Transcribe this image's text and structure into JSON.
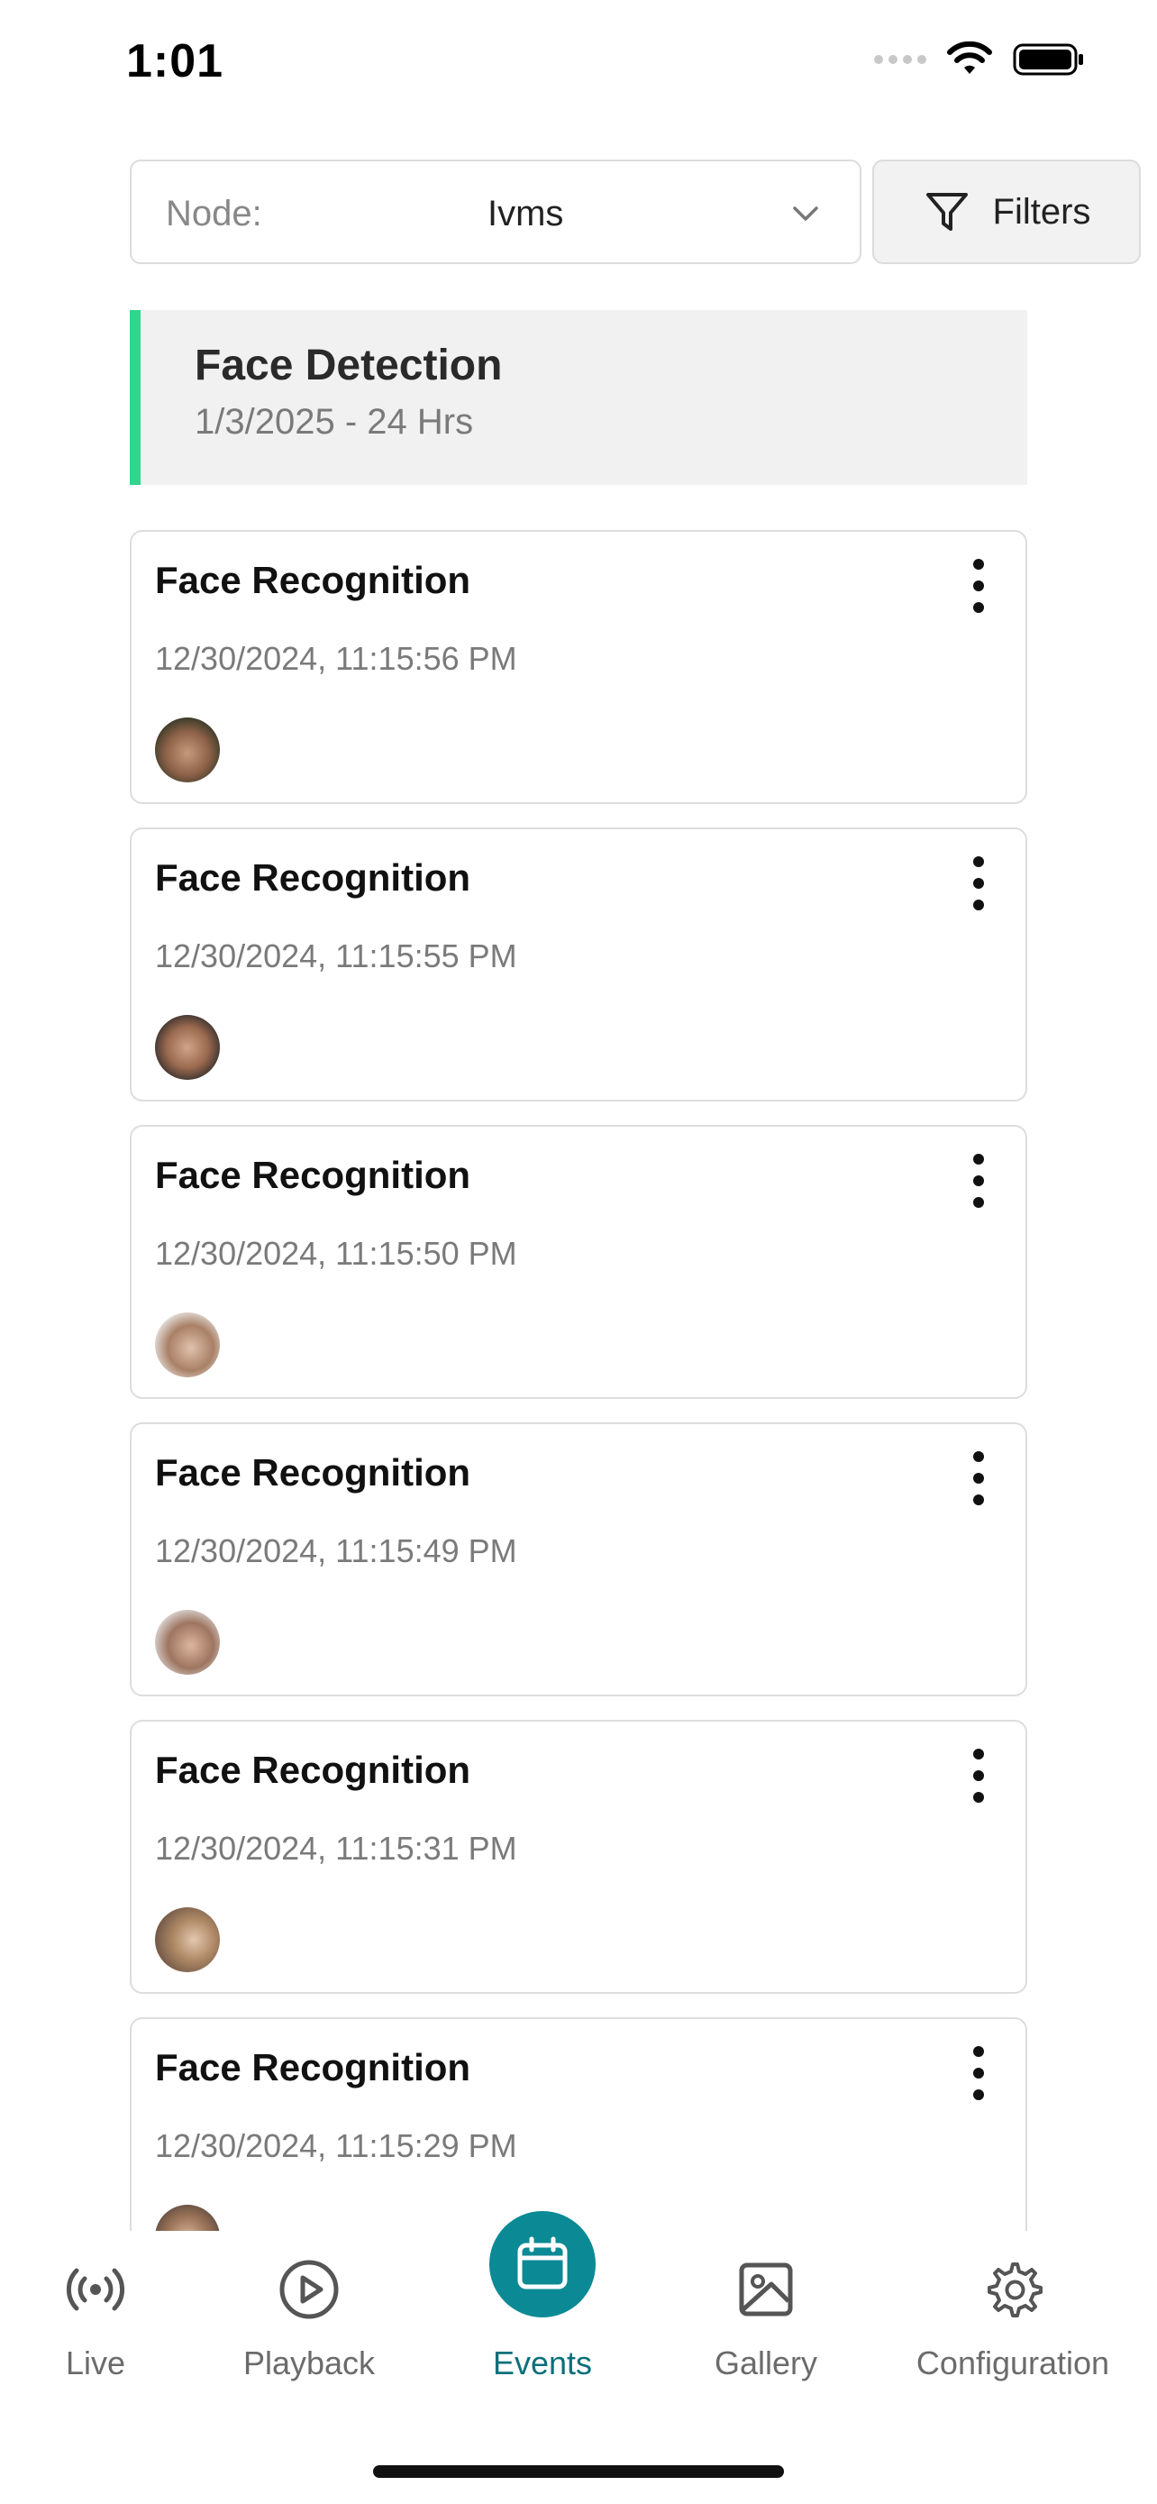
{
  "status_bar": {
    "time": "1:01"
  },
  "node_select": {
    "label": "Node:",
    "value": "Ivms"
  },
  "filters_button": {
    "label": "Filters"
  },
  "detection_banner": {
    "title": "Face Detection",
    "subtitle": "1/3/2025 - 24 Hrs",
    "accent_color": "#2ed68e"
  },
  "events": [
    {
      "title": "Face Recognition",
      "time": "12/30/2024, 11:15:56 PM"
    },
    {
      "title": "Face Recognition",
      "time": "12/30/2024, 11:15:55 PM"
    },
    {
      "title": "Face Recognition",
      "time": "12/30/2024, 11:15:50 PM"
    },
    {
      "title": "Face Recognition",
      "time": "12/30/2024, 11:15:49 PM"
    },
    {
      "title": "Face Recognition",
      "time": "12/30/2024, 11:15:31 PM"
    },
    {
      "title": "Face Recognition",
      "time": "12/30/2024, 11:15:29 PM"
    }
  ],
  "bottom_nav": {
    "active_color": "#0b8a95",
    "items": [
      {
        "label": "Live",
        "icon": "broadcast-icon"
      },
      {
        "label": "Playback",
        "icon": "play-circle-icon"
      },
      {
        "label": "Events",
        "icon": "calendar-icon"
      },
      {
        "label": "Gallery",
        "icon": "image-icon"
      },
      {
        "label": "Configuration",
        "icon": "gear-icon"
      }
    ]
  }
}
